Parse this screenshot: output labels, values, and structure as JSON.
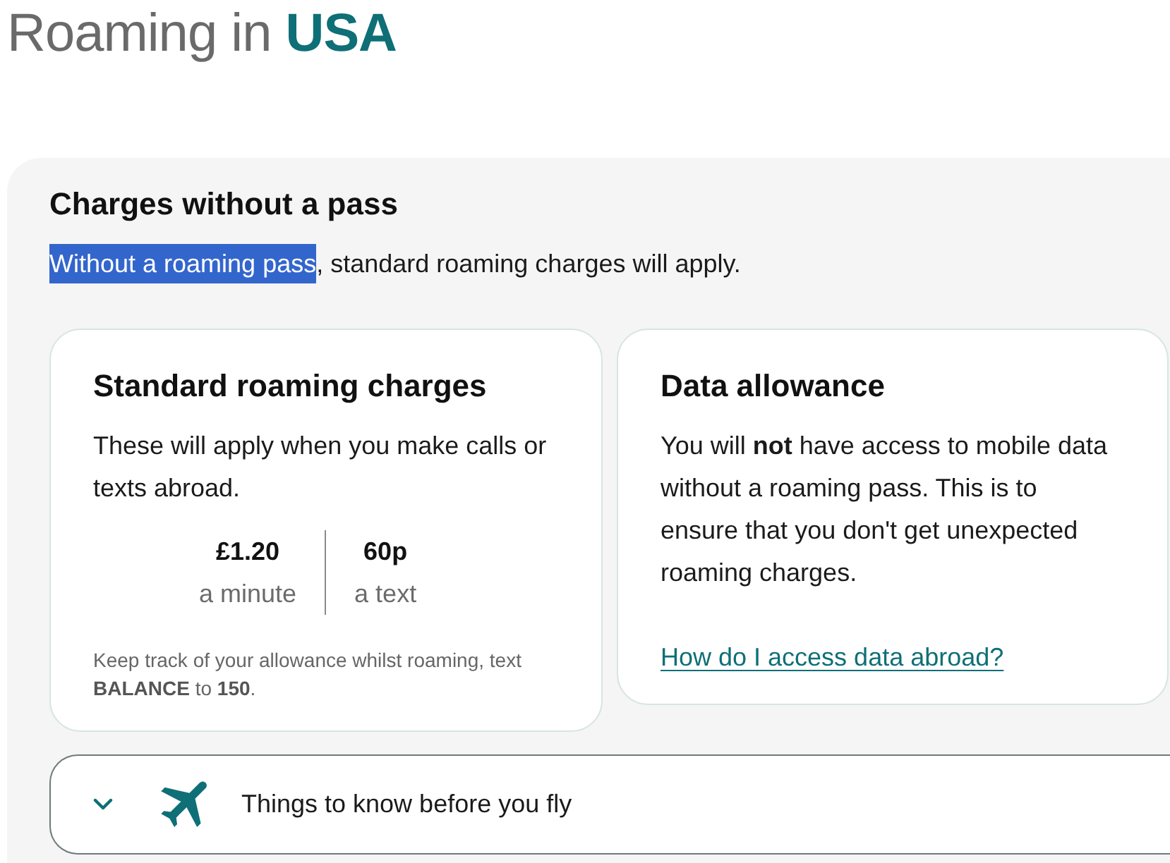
{
  "page": {
    "title": "Roaming in **USA**"
  },
  "section": {
    "heading": "Charges without a pass",
    "intro": {
      "selected_text": "Without a roaming pass",
      "text": ", standard roaming charges will apply."
    }
  },
  "cards": [
    {
      "kind": "charges",
      "title": "Standard roaming charges",
      "description": "These will apply when you make calls or texts abroad.",
      "rates": [
        {
          "price": "£1.20",
          "unit": "a minute"
        },
        {
          "price": "60p",
          "unit": "a text"
        }
      ],
      "note": "Keep track of your allowance whilst roaming, text **BALANCE** to **150**."
    },
    {
      "kind": "data",
      "title": "Data allowance",
      "description": "You will **not** have access to mobile data without a roaming pass. This is to ensure that you don't get unexpected roaming charges.",
      "link": "How do I access data abroad?"
    }
  ],
  "accordion": {
    "label": "Things to know before you fly",
    "expanded": false
  }
}
